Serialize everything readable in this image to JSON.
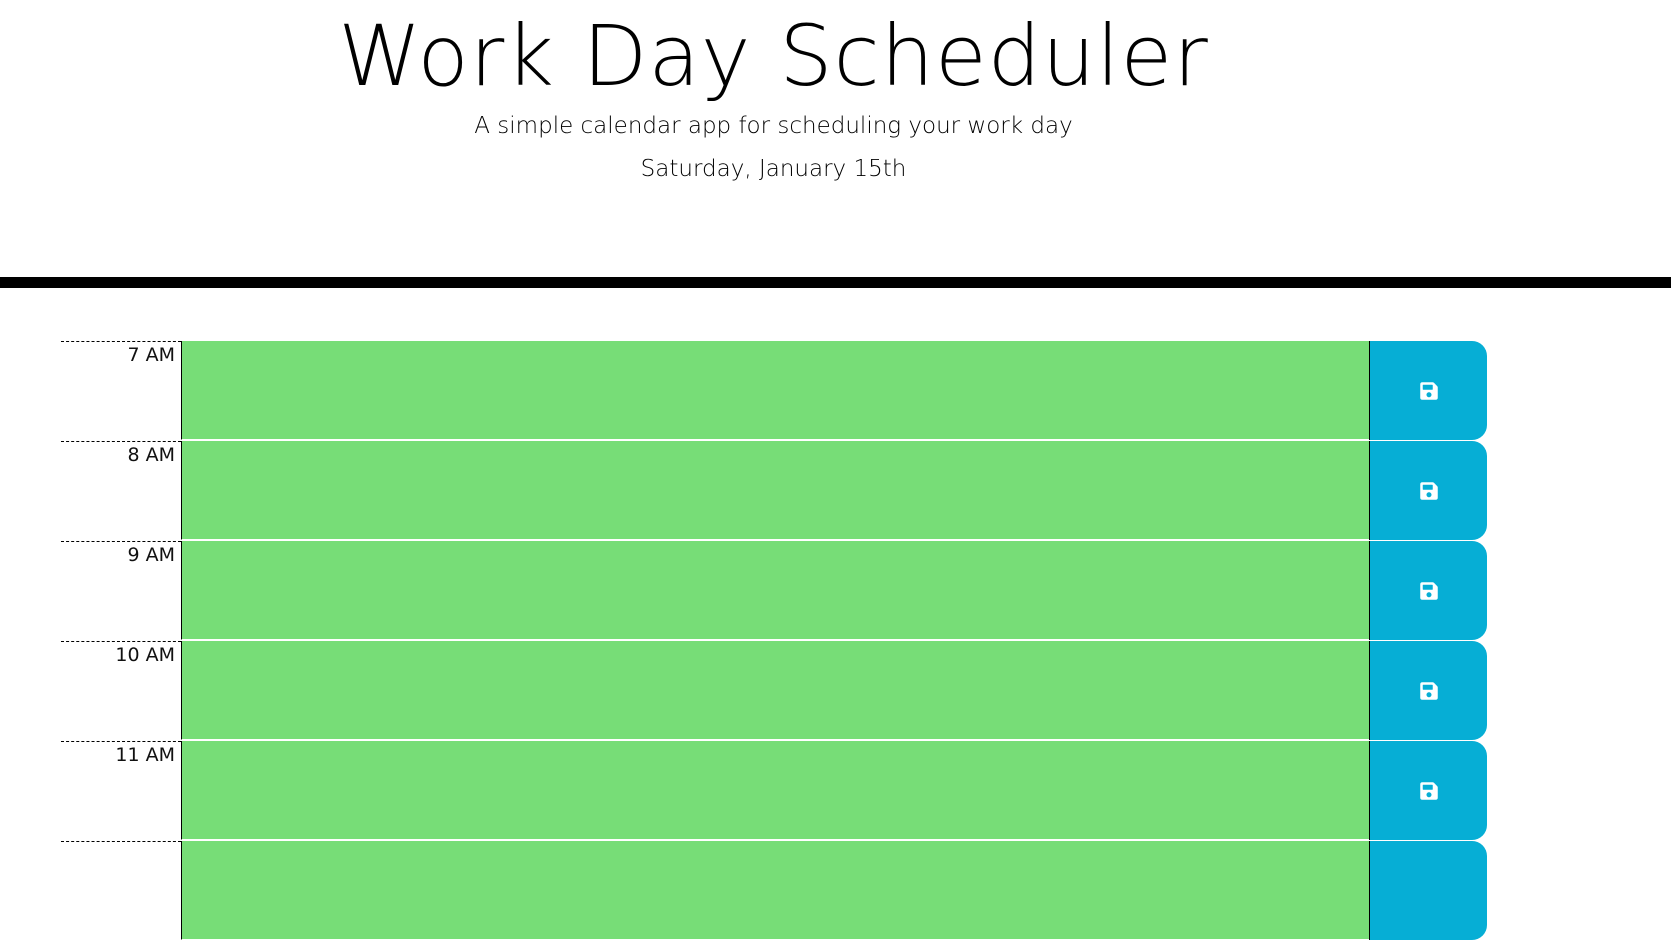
{
  "header": {
    "title": "Work Day Scheduler",
    "subtitle": "A simple calendar app for scheduling your work day",
    "date": "Saturday, January 15th"
  },
  "colors": {
    "present_or_future_block": "#77dd77",
    "save_button": "#06aed5"
  },
  "time_blocks": [
    {
      "hour": "7 AM",
      "description": "",
      "save_icon": "floppy-disk-icon"
    },
    {
      "hour": "8 AM",
      "description": "",
      "save_icon": "floppy-disk-icon"
    },
    {
      "hour": "9 AM",
      "description": "",
      "save_icon": "floppy-disk-icon"
    },
    {
      "hour": "10 AM",
      "description": "",
      "save_icon": "floppy-disk-icon"
    },
    {
      "hour": "11 AM",
      "description": "",
      "save_icon": "floppy-disk-icon"
    }
  ]
}
